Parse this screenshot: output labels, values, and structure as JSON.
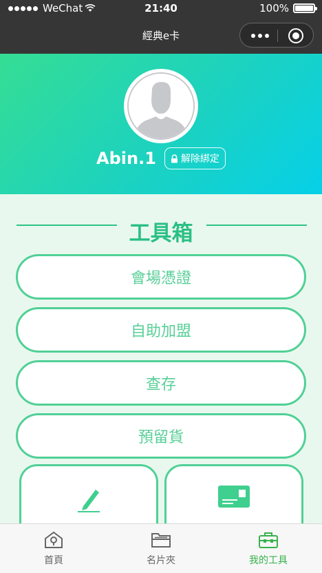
{
  "status_bar": {
    "carrier": "WeChat",
    "time": "21:40",
    "battery": "100%"
  },
  "navbar": {
    "title": "經典e卡"
  },
  "profile": {
    "username": "Abin.1",
    "unbind_label": "解除綁定"
  },
  "toolbox": {
    "title": "工具箱",
    "buttons": [
      "會場憑證",
      "自助加盟",
      "查存",
      "預留貨"
    ]
  },
  "tabbar": {
    "items": [
      {
        "label": "首頁",
        "icon": "home-icon"
      },
      {
        "label": "名片夾",
        "icon": "folder-icon"
      },
      {
        "label": "我的工具",
        "icon": "toolbox-icon"
      }
    ],
    "active_color": "#37b24d"
  },
  "colors": {
    "accent": "#2bbf85",
    "button_border": "#50d096",
    "button_text": "#58cf97"
  }
}
